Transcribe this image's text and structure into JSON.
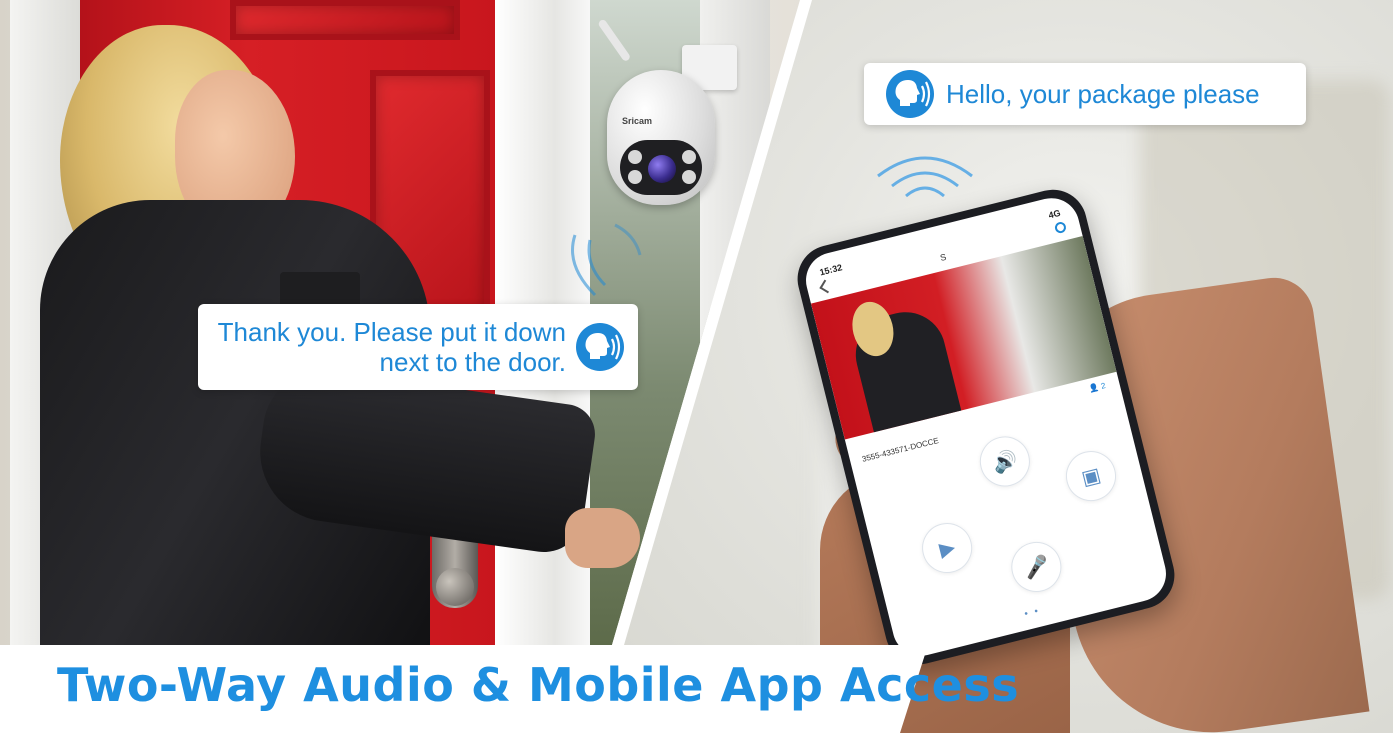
{
  "headline": "Two-Way Audio & Mobile App Access",
  "bubble_visitor": {
    "line1": "Thank you. Please put it down",
    "line2": "next to the door."
  },
  "bubble_app": {
    "text": "Hello, your package please"
  },
  "camera": {
    "brand": "Sricam"
  },
  "phone": {
    "time": "15:32",
    "signal": "4G",
    "page_title": "S",
    "viewers": "2",
    "device_id": "3555-433571-DOCCE",
    "controls": [
      "speaker-icon",
      "snapshot-icon",
      "record-icon",
      "microphone-icon"
    ]
  },
  "colors": {
    "accent": "#1e88d6",
    "headline": "#1e8fe0",
    "door_red": "#d61f25"
  }
}
